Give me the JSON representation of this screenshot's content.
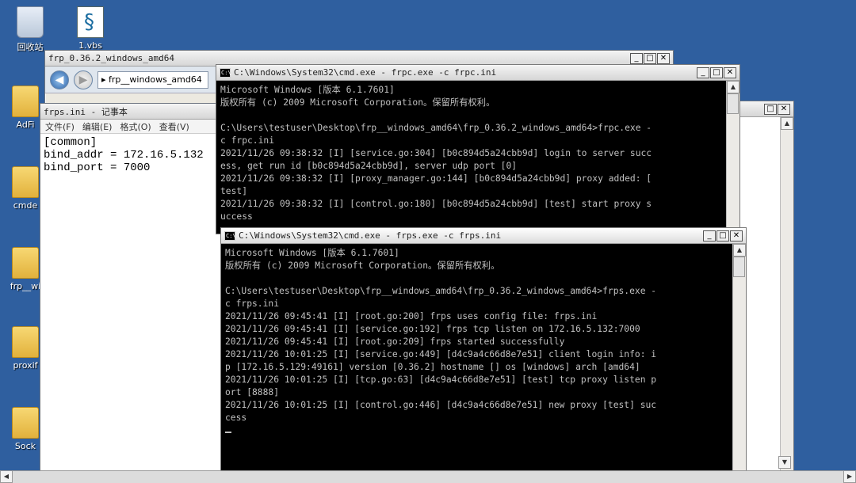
{
  "desktop": {
    "icons": [
      {
        "label": "回收站",
        "type": "recycle-bin"
      },
      {
        "label": "1.vbs",
        "type": "script"
      },
      {
        "label": "AdFi",
        "type": "folder"
      },
      {
        "label": "cmde",
        "type": "folder"
      },
      {
        "label": "frp__wi",
        "type": "folder"
      },
      {
        "label": "proxif",
        "type": "folder"
      },
      {
        "label": "Sock",
        "type": "folder"
      }
    ]
  },
  "explorer": {
    "title": "frp_0.36.2_windows_amd64",
    "address": "▸ frp__windows_amd64"
  },
  "notepad": {
    "title": "frps.ini - 记事本",
    "menu": [
      "文件(F)",
      "编辑(E)",
      "格式(O)",
      "查看(V)"
    ],
    "content": "[common]\nbind_addr = 172.16.5.132\nbind_port = 7000"
  },
  "frpc_console": {
    "title": "C:\\Windows\\System32\\cmd.exe - frpc.exe  -c frpc.ini",
    "text": "Microsoft Windows [版本 6.1.7601]\n版权所有 (c) 2009 Microsoft Corporation。保留所有权利。\n\nC:\\Users\\testuser\\Desktop\\frp__windows_amd64\\frp_0.36.2_windows_amd64>frpc.exe -\nc frpc.ini\n2021/11/26 09:38:32 [I] [service.go:304] [b0c894d5a24cbb9d] login to server succ\ness, get run id [b0c894d5a24cbb9d], server udp port [0]\n2021/11/26 09:38:32 [I] [proxy_manager.go:144] [b0c894d5a24cbb9d] proxy added: [\ntest]\n2021/11/26 09:38:32 [I] [control.go:180] [b0c894d5a24cbb9d] [test] start proxy s\nuccess"
  },
  "frps_console": {
    "title": "C:\\Windows\\System32\\cmd.exe - frps.exe  -c frps.ini",
    "text": "Microsoft Windows [版本 6.1.7601]\n版权所有 (c) 2009 Microsoft Corporation。保留所有权利。\n\nC:\\Users\\testuser\\Desktop\\frp__windows_amd64\\frp_0.36.2_windows_amd64>frps.exe -\nc frps.ini\n2021/11/26 09:45:41 [I] [root.go:200] frps uses config file: frps.ini\n2021/11/26 09:45:41 [I] [service.go:192] frps tcp listen on 172.16.5.132:7000\n2021/11/26 09:45:41 [I] [root.go:209] frps started successfully\n2021/11/26 10:01:25 [I] [service.go:449] [d4c9a4c66d8e7e51] client login info: i\np [172.16.5.129:49161] version [0.36.2] hostname [] os [windows] arch [amd64]\n2021/11/26 10:01:25 [I] [tcp.go:63] [d4c9a4c66d8e7e51] [test] tcp proxy listen p\nort [8888]\n2021/11/26 10:01:25 [I] [control.go:446] [d4c9a4c66d8e7e51] new proxy [test] suc\ncess"
  },
  "window_controls": {
    "minimize": "_",
    "maximize": "□",
    "close": "✕"
  },
  "colors": {
    "desktop": "#2f5f9f",
    "console_bg": "#000000",
    "console_fg": "#c0c0c0"
  }
}
